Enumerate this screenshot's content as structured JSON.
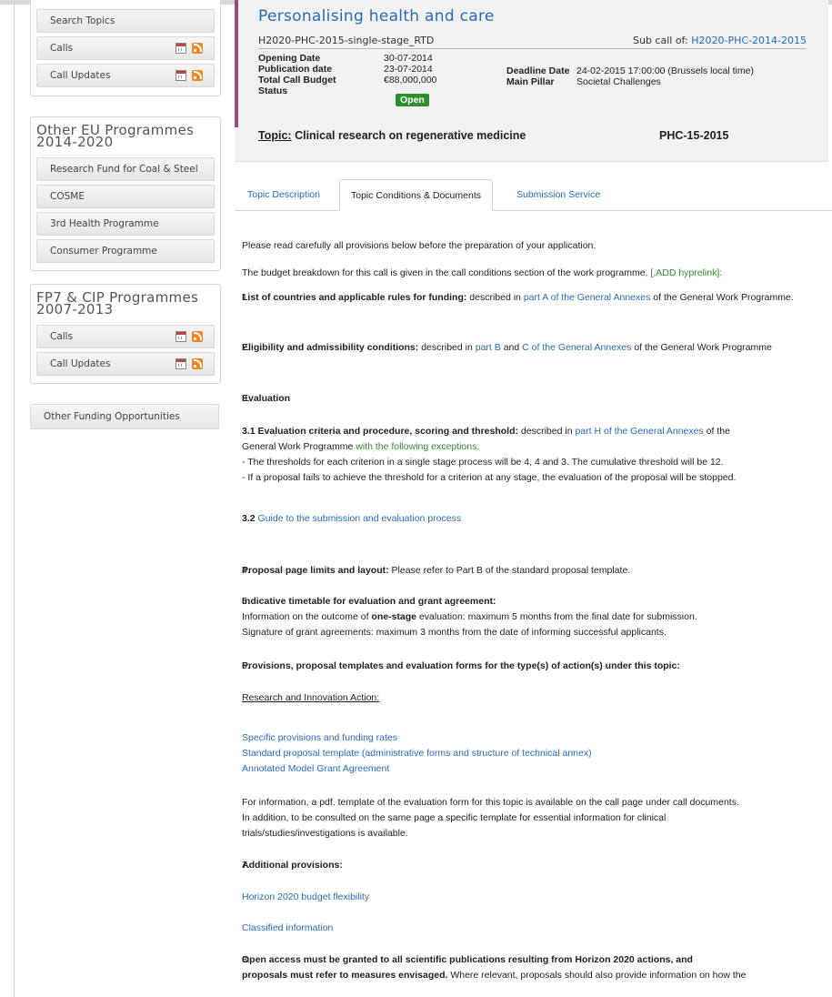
{
  "sidebar": {
    "box1": {
      "items": [
        {
          "label": "Search Topics"
        },
        {
          "label": "Calls"
        },
        {
          "label": "Call Updates"
        }
      ]
    },
    "box2": {
      "title": "Other EU Programmes 2014-2020",
      "items": [
        {
          "label": "Research Fund for Coal & Steel"
        },
        {
          "label": "COSME"
        },
        {
          "label": "3rd Health Programme"
        },
        {
          "label": "Consumer Programme"
        }
      ]
    },
    "box3": {
      "title": "FP7 & CIP Programmes 2007-2013",
      "items": [
        {
          "label": "Calls"
        },
        {
          "label": "Call Updates"
        }
      ]
    },
    "other_funding": "Other Funding Opportunities",
    "icons": [
      "calendar-icon",
      "rss-icon"
    ]
  },
  "header": {
    "title": "Personalising health and care",
    "call_id": "H2020-PHC-2015-single-stage_RTD",
    "subcall_prefix": "Sub call of:",
    "subcall_link": "H2020-PHC-2014-2015",
    "opening_date_label": "Opening Date",
    "opening_date": "30-07-2014",
    "publication_date_label": "Publication date",
    "publication_date": "23-07-2014",
    "total_budget_label": "Total Call Budget",
    "total_budget": "€88,000,000",
    "status_label": "Status",
    "status": "Open",
    "deadline_label": "Deadline Date",
    "deadline": "24-02-2015 17:00:00 (Brussels local time)",
    "pillar_label": "Main Pillar",
    "pillar": "Societal Challenges",
    "topic_label": "Topic:",
    "topic": "Clinical research on regenerative medicine",
    "topic_code": "PHC-15-2015",
    "accent_color": "#8f4e86",
    "status_color": "#2f8f2f",
    "link_color": "#2a6ab8"
  },
  "tabs": [
    {
      "label": "Topic Description"
    },
    {
      "label": "Topic Conditions & Documents"
    },
    {
      "label": "Submission Service"
    }
  ],
  "content": {
    "intro1": "Please read carefully all provisions below before the preparation of your application.",
    "intro2": "The budget breakdown for this call is given in the call conditions section of the work programme.",
    "intro2_link": "[,ADD hyprelink]:",
    "s1_num": "1.",
    "s1_bold": "List of countries and applicable rules for funding:",
    "s1_text": "described in",
    "s1_link": "part A of the General Annexes",
    "s1_tail": "of the General Work Programme.",
    "s2_num": "2.",
    "s2_bold": "Eligibility and admissibility conditions:",
    "s2_text": "described in",
    "s2_link1": "part B",
    "s2_and": "and",
    "s2_link2": "C of the General Annexes",
    "s2_tail": "of the General Work Programme",
    "s3_num": "3.",
    "s3_bold": "Evaluation",
    "s31_bold": "3.1  Evaluation criteria and procedure, scoring and threshold:",
    "s31_text": "described in",
    "s31_link": "part H of the General Annexes",
    "s31_tail": "of the",
    "s31_line2": "General Work Programme",
    "s31_green": "with the following exceptions:",
    "s31_b1": "- The thresholds for each criterion in a single stage process will be 4, 4 and 3. The cumulative threshold will be 12.",
    "s31_b2": "- If a proposal fails to achieve the threshold for a criterion at any stage, the evaluation of the proposal will be stopped.",
    "s32_bold": "3.2",
    "s32_link": "Guide to the submission and evaluation process",
    "s4_num": "4.",
    "s4_bold": "Proposal page limits and layout:",
    "s4_text": "Please refer to Part B of the standard proposal template.",
    "s5_num": "5.",
    "s5_bold": "Indicative timetable for evaluation and grant agreement:",
    "s5_l1a": "Information on the outcome of",
    "s5_l1b": "one-stage",
    "s5_l1c": "evaluation: maximum 5 months from the final date for submission.",
    "s5_l2": "Signature of grant agreements: maximum 3 months from the date of informing successful applicants.",
    "s6_num": "6.",
    "s6_bold": "Provisions, proposal templates and evaluation forms for the type(s) of action(s) under this topic:",
    "s6_ria": "Research and Innovation Action:",
    "s6_link1": "Specific provisions and funding rates",
    "s6_link2": "Standard proposal template (administrative forms and structure of technical annex)",
    "s6_link3": "Annotated Model Grant Agreement",
    "s6_p1": "For information, a pdf. template of the evaluation form for this topic is available on the call page under call documents.",
    "s6_p2": "In addition, to be consulted on the same page a specific template for essential information for clinical",
    "s6_p3": "trials/studies/investigations is available.",
    "s7_num": "7.",
    "s7_bold": "Additional provisions:",
    "s7_link1": "Horizon 2020 budget flexibility",
    "s7_link2": "Classified information",
    "s8_num": "8.",
    "s8_bold1": "Open access must be granted to all scientific publications resulting from Horizon 2020 actions, and",
    "s8_bold2": "proposals must refer to measures envisaged.",
    "s8_tail": "Where relevant, proposals should also provide information on how the"
  }
}
